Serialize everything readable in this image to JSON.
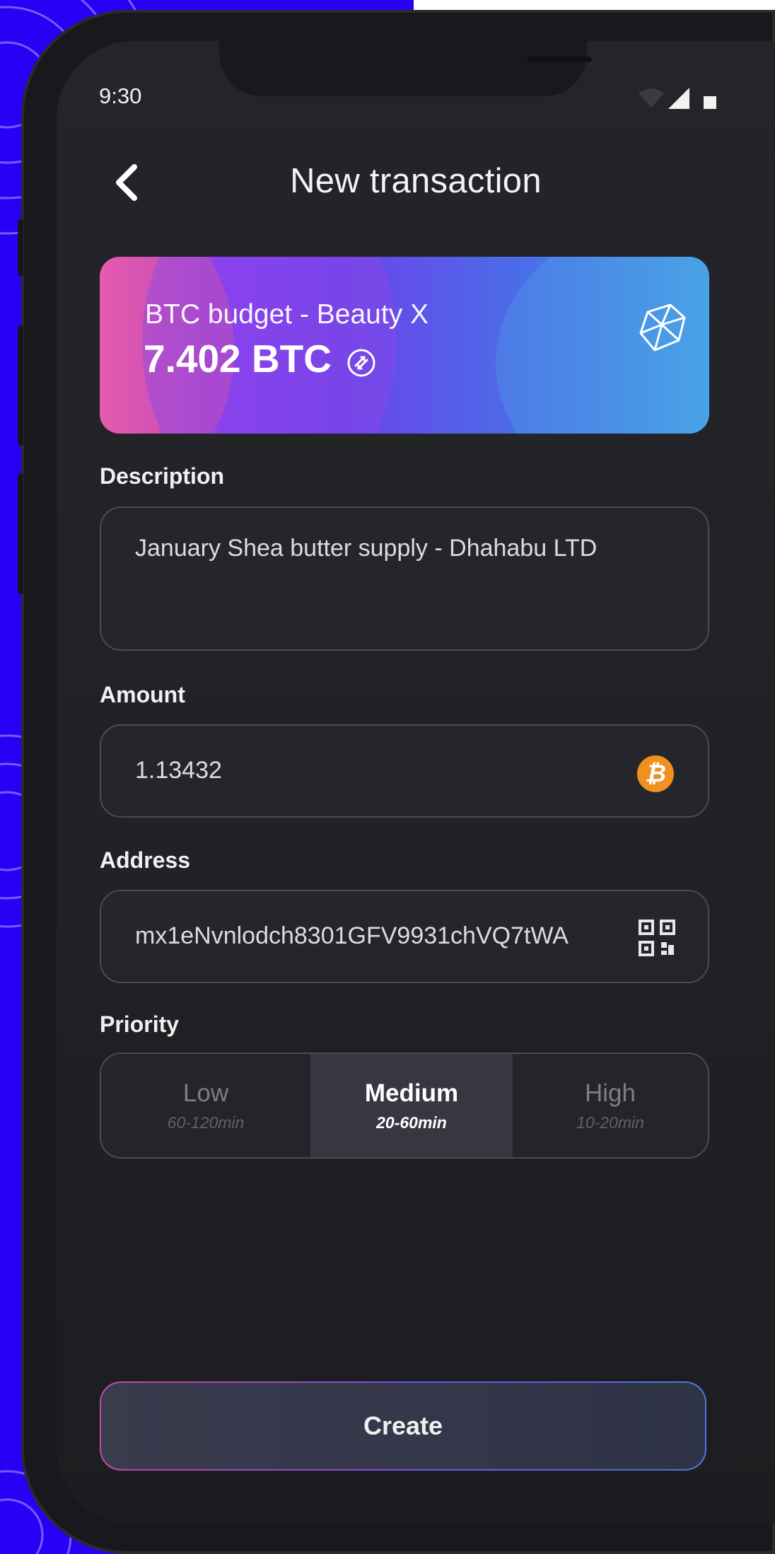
{
  "status_bar": {
    "time": "9:30"
  },
  "header": {
    "title": "New transaction"
  },
  "wallet_card": {
    "name": "BTC budget - Beauty X",
    "balance": "7.402 BTC"
  },
  "form": {
    "description": {
      "label": "Description",
      "value": "January Shea butter supply - Dhahabu LTD"
    },
    "amount": {
      "label": "Amount",
      "value": "1.13432",
      "currency_icon": "bitcoin-icon",
      "currency_glyph": "₿"
    },
    "address": {
      "label": "Address",
      "value": "mx1eNvnlodch8301GFV9931chVQ7tWA",
      "scan_icon": "qr-code-icon"
    },
    "priority": {
      "label": "Priority",
      "options": [
        {
          "label": "Low",
          "time": "60-120min"
        },
        {
          "label": "Medium",
          "time": "20-60min"
        },
        {
          "label": "High",
          "time": "10-20min"
        }
      ],
      "selected": "Medium"
    }
  },
  "create_button": {
    "label": "Create"
  },
  "colors": {
    "background_accent": "#2a00f5",
    "screen": "#202226",
    "bitcoin": "#f0901f",
    "card_gradient_start": "#e35cc6",
    "card_gradient_end": "#47a4e6"
  }
}
